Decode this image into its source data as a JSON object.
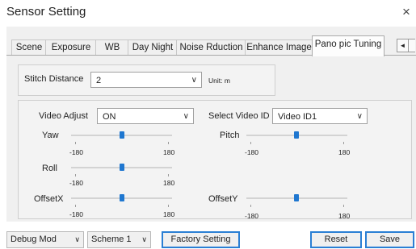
{
  "window": {
    "title": "Sensor Setting",
    "close_glyph": "×"
  },
  "tabs": [
    {
      "label": "Scene"
    },
    {
      "label": "Exposure"
    },
    {
      "label": "WB"
    },
    {
      "label": "Day Night"
    },
    {
      "label": "Noise Rduction"
    },
    {
      "label": "Enhance Image"
    },
    {
      "label": "Pano pic Tuning",
      "active": true
    }
  ],
  "tab_nav": {
    "prev_glyph": "◄",
    "next_glyph": "►"
  },
  "stitch": {
    "label": "Stitch Distance",
    "value": "2",
    "unit": "Unit: m"
  },
  "video_adjust": {
    "label": "Video Adjust",
    "value": "ON"
  },
  "select_video": {
    "label": "Select Video ID",
    "value": "Video ID1"
  },
  "sliders": {
    "yaw": {
      "label": "Yaw",
      "min": "-180",
      "max": "180",
      "value": 0
    },
    "pitch": {
      "label": "Pitch",
      "min": "-180",
      "max": "180",
      "value": 0
    },
    "roll": {
      "label": "Roll",
      "min": "-180",
      "max": "180",
      "value": 0
    },
    "offsetx": {
      "label": "OffsetX",
      "min": "-180",
      "max": "180",
      "value": 0
    },
    "offsety": {
      "label": "OffsetY",
      "min": "-180",
      "max": "180",
      "value": 0
    }
  },
  "footer": {
    "debug_mode": "Debug Mod",
    "scheme": "Scheme 1",
    "factory": "Factory Setting",
    "reset": "Reset",
    "save": "Save"
  },
  "accent_color": "#2a7fd4",
  "icons": {
    "dropdown": "chevron-down-icon",
    "close": "close-icon"
  }
}
